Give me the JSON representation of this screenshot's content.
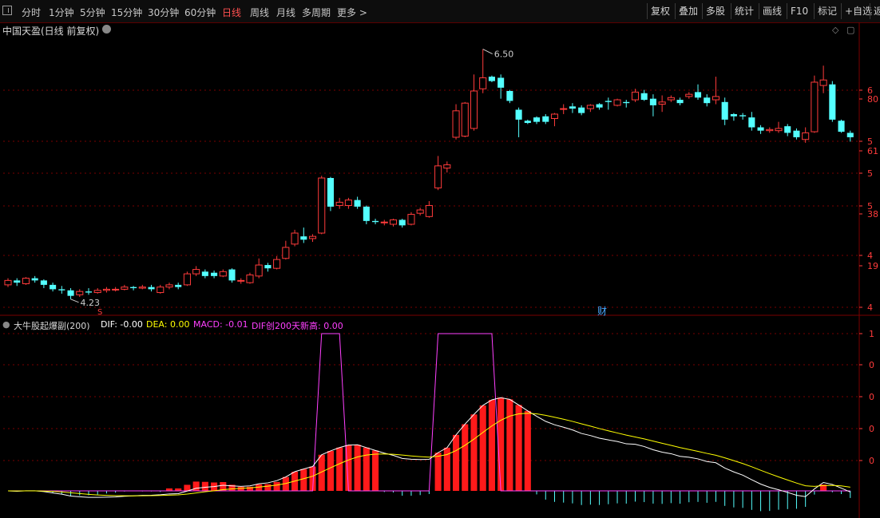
{
  "toolbar": {
    "periods": [
      "分时",
      "1分钟",
      "5分钟",
      "15分钟",
      "30分钟",
      "60分钟",
      "日线",
      "周线",
      "月线",
      "多周期",
      "更多 >"
    ],
    "active_period": "日线",
    "right_tools": [
      "复权",
      "叠加",
      "多股",
      "统计",
      "画线",
      "F10",
      "标记",
      "+自选",
      "返"
    ]
  },
  "chart": {
    "title": "中国天盈(日线 前复权)",
    "price_high_label": "6.50",
    "price_low_label": "4.23",
    "event_mark_s": "S",
    "event_mark_cai": "财",
    "right_axis_labels": [
      "6",
      "80",
      "5",
      "61",
      "5",
      "5",
      "38",
      "4",
      "19",
      "4"
    ],
    "indicator_axis_labels": [
      "1",
      "0",
      "0",
      "0",
      "0"
    ],
    "indicator": {
      "name": "大牛股起爆副(200)",
      "dif": "DIF: -0.00",
      "dea": "DEA: 0.00",
      "macd": "MACD: -0.01",
      "dif_high": "DIF创200天新高: 0.00"
    },
    "colors": {
      "up": "#ff3b3b",
      "down": "#54ffff",
      "dif": "#ffffff",
      "dea": "#ffff00",
      "signal": "#ff40ff",
      "grid": "#7a0000"
    }
  },
  "chart_data": {
    "type": "candlestick",
    "candles": [
      [
        4.36,
        4.4,
        4.34,
        4.42
      ],
      [
        4.4,
        4.38,
        4.35,
        4.42
      ],
      [
        4.37,
        4.42,
        4.36,
        4.43
      ],
      [
        4.42,
        4.4,
        4.38,
        4.44
      ],
      [
        4.4,
        4.36,
        4.33,
        4.41
      ],
      [
        4.36,
        4.32,
        4.3,
        4.38
      ],
      [
        4.32,
        4.31,
        4.28,
        4.35
      ],
      [
        4.31,
        4.26,
        4.23,
        4.33
      ],
      [
        4.27,
        4.3,
        4.25,
        4.32
      ],
      [
        4.3,
        4.29,
        4.27,
        4.33
      ],
      [
        4.29,
        4.31,
        4.28,
        4.33
      ],
      [
        4.31,
        4.32,
        4.29,
        4.34
      ],
      [
        4.32,
        4.32,
        4.3,
        4.34
      ],
      [
        4.32,
        4.34,
        4.31,
        4.36
      ],
      [
        4.34,
        4.33,
        4.31,
        4.35
      ],
      [
        4.33,
        4.34,
        4.32,
        4.36
      ],
      [
        4.34,
        4.32,
        4.3,
        4.36
      ],
      [
        4.29,
        4.34,
        4.28,
        4.36
      ],
      [
        4.34,
        4.36,
        4.32,
        4.38
      ],
      [
        4.36,
        4.34,
        4.32,
        4.38
      ],
      [
        4.36,
        4.46,
        4.35,
        4.48
      ],
      [
        4.46,
        4.5,
        4.44,
        4.53
      ],
      [
        4.48,
        4.44,
        4.42,
        4.5
      ],
      [
        4.47,
        4.44,
        4.42,
        4.49
      ],
      [
        4.44,
        4.48,
        4.43,
        4.5
      ],
      [
        4.5,
        4.4,
        4.38,
        4.51
      ],
      [
        4.4,
        4.4,
        4.37,
        4.42
      ],
      [
        4.38,
        4.45,
        4.37,
        4.47
      ],
      [
        4.44,
        4.54,
        4.42,
        4.6
      ],
      [
        4.54,
        4.51,
        4.48,
        4.56
      ],
      [
        4.51,
        4.59,
        4.5,
        4.62
      ],
      [
        4.6,
        4.7,
        4.59,
        4.76
      ],
      [
        4.73,
        4.83,
        4.71,
        4.86
      ],
      [
        4.8,
        4.77,
        4.74,
        4.88
      ],
      [
        4.78,
        4.8,
        4.75,
        4.82
      ],
      [
        4.83,
        5.33,
        4.82,
        5.35
      ],
      [
        5.33,
        5.07,
        5.03,
        5.34
      ],
      [
        5.08,
        5.11,
        5.05,
        5.15
      ],
      [
        5.08,
        5.13,
        5.05,
        5.15
      ],
      [
        5.13,
        5.07,
        5.05,
        5.16
      ],
      [
        5.07,
        4.94,
        4.91,
        5.08
      ],
      [
        4.94,
        4.93,
        4.91,
        4.96
      ],
      [
        4.93,
        4.93,
        4.9,
        4.95
      ],
      [
        4.91,
        4.95,
        4.89,
        4.96
      ],
      [
        4.95,
        4.9,
        4.88,
        4.96
      ],
      [
        4.91,
        5.0,
        4.9,
        5.02
      ],
      [
        5.01,
        5.04,
        4.99,
        5.06
      ],
      [
        4.98,
        5.08,
        4.97,
        5.12
      ],
      [
        5.24,
        5.44,
        5.22,
        5.53
      ],
      [
        5.42,
        5.45,
        5.38,
        5.48
      ],
      [
        5.7,
        5.94,
        5.68,
        6.0
      ],
      [
        5.71,
        6.01,
        5.7,
        6.02
      ],
      [
        5.78,
        6.12,
        5.76,
        6.27
      ],
      [
        6.14,
        6.24,
        6.1,
        6.5
      ],
      [
        6.25,
        6.21,
        6.2,
        6.26
      ],
      [
        6.24,
        6.15,
        6.05,
        6.27
      ],
      [
        6.12,
        6.03,
        6.01,
        6.13
      ],
      [
        5.95,
        5.86,
        5.7,
        5.97
      ],
      [
        5.85,
        5.83,
        5.82,
        5.86
      ],
      [
        5.88,
        5.84,
        5.82,
        5.89
      ],
      [
        5.89,
        5.84,
        5.82,
        5.91
      ],
      [
        5.87,
        5.91,
        5.8,
        5.92
      ],
      [
        5.96,
        5.96,
        5.91,
        6.0
      ],
      [
        5.98,
        5.96,
        5.92,
        6.01
      ],
      [
        5.97,
        5.92,
        5.9,
        5.99
      ],
      [
        5.96,
        5.99,
        5.93,
        6.0
      ],
      [
        6.0,
        5.97,
        5.95,
        6.01
      ],
      [
        6.03,
        6.02,
        5.95,
        6.06
      ],
      [
        5.99,
        6.04,
        5.98,
        6.05
      ],
      [
        6.02,
        6.01,
        5.97,
        6.04
      ],
      [
        6.04,
        6.11,
        6.02,
        6.14
      ],
      [
        6.1,
        6.04,
        6.03,
        6.13
      ],
      [
        6.05,
        5.99,
        5.89,
        6.09
      ],
      [
        6.0,
        6.02,
        5.93,
        6.08
      ],
      [
        6.04,
        6.06,
        6.02,
        6.08
      ],
      [
        6.04,
        6.01,
        5.99,
        6.06
      ],
      [
        6.07,
        6.09,
        6.05,
        6.11
      ],
      [
        6.11,
        6.06,
        6.04,
        6.18
      ],
      [
        6.06,
        6.01,
        5.98,
        6.09
      ],
      [
        6.04,
        6.07,
        6.0,
        6.25
      ],
      [
        6.02,
        5.86,
        5.81,
        6.06
      ],
      [
        5.91,
        5.89,
        5.85,
        5.92
      ],
      [
        5.9,
        5.89,
        5.86,
        5.92
      ],
      [
        5.88,
        5.79,
        5.76,
        5.93
      ],
      [
        5.79,
        5.76,
        5.73,
        5.81
      ],
      [
        5.76,
        5.77,
        5.74,
        5.79
      ],
      [
        5.76,
        5.78,
        5.74,
        5.84
      ],
      [
        5.8,
        5.74,
        5.71,
        5.82
      ],
      [
        5.76,
        5.7,
        5.68,
        5.78
      ],
      [
        5.68,
        5.74,
        5.65,
        5.79
      ],
      [
        5.75,
        6.2,
        5.74,
        6.26
      ],
      [
        6.17,
        6.22,
        6.1,
        6.35
      ],
      [
        6.18,
        5.86,
        5.84,
        6.21
      ],
      [
        5.85,
        5.75,
        5.74,
        5.86
      ],
      [
        5.74,
        5.7,
        5.66,
        5.76
      ]
    ],
    "macd_hist_positive": [
      0.0,
      0.0,
      0.0,
      0.0,
      0.0,
      0.0,
      0.0,
      0.0,
      0.0,
      0.0,
      0.0,
      0.0,
      0.0,
      0.0,
      0.0,
      0.0,
      0.0,
      0.0,
      0.0,
      0.0,
      0.0,
      0.0,
      0.0,
      0.0,
      0.0,
      0.0,
      0.0,
      0.0,
      0.0,
      0.0,
      0.0,
      0.0,
      0.0,
      0.0,
      0.0,
      0.0,
      0.0,
      0.0,
      0.0,
      0.0,
      0.0,
      0.0,
      0.0,
      0.0,
      0.0,
      0.0,
      0.0,
      0.0,
      0.0,
      0.0,
      0.0,
      0.0,
      0.0,
      0.0,
      0.0,
      0.0,
      0.0,
      0.0,
      0.0,
      0.0,
      0.0,
      0.0,
      0.0,
      0.0,
      0.0,
      0.0,
      0.0,
      0.0,
      0.0,
      0.0,
      0.0,
      0.0,
      0.0,
      0.0,
      0.0,
      0.0,
      0.0,
      0.0,
      0.0,
      0.0,
      0.0,
      0.0,
      0.0,
      0.0,
      0.0,
      0.0,
      0.0,
      0.0,
      0.0,
      0.0,
      0.0,
      0.0,
      0.0,
      0.0,
      0.0
    ]
  }
}
